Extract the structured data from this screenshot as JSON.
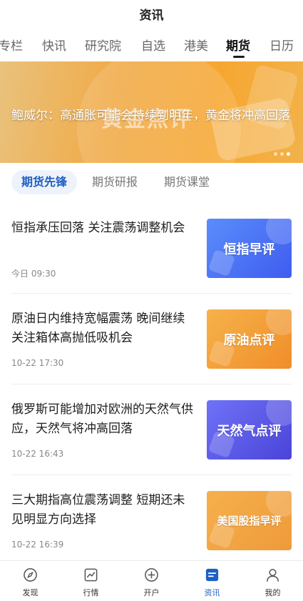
{
  "header": {
    "title": "资讯"
  },
  "tabs": [
    {
      "label": "专栏"
    },
    {
      "label": "快讯"
    },
    {
      "label": "研究院"
    },
    {
      "label": "自选"
    },
    {
      "label": "港美"
    },
    {
      "label": "期货",
      "active": true
    },
    {
      "label": "日历"
    }
  ],
  "banner": {
    "caption": "鲍威尔：高通胀可能会持续到明年，黄金将冲高回落",
    "watermark": "黄金点评",
    "slide_count": 3,
    "active_slide": 3
  },
  "subtabs": [
    {
      "label": "期货先锋",
      "active": true
    },
    {
      "label": "期货研报"
    },
    {
      "label": "期货课堂"
    }
  ],
  "news": [
    {
      "title": "恒指承压回落 关注震荡调整机会",
      "time": "今日 09:30",
      "thumb_label": "恒指早评",
      "thumb_color": "#4f6ff2"
    },
    {
      "title": "原油日内维持宽幅震荡 晚间继续关注箱体高抛低吸机会",
      "time": "10-22 17:30",
      "thumb_label": "原油点评",
      "thumb_color": "#f3a23b"
    },
    {
      "title": "俄罗斯可能增加对欧洲的天然气供应，天然气将冲高回落",
      "time": "10-22 16:43",
      "thumb_label": "天然气点评",
      "thumb_color": "#5a55e6"
    },
    {
      "title": "三大期指高位震荡调整 短期还未见明显方向选择",
      "time": "10-22 16:39",
      "thumb_label": "美国股指早评",
      "thumb_color": "#f2a444"
    }
  ],
  "bottom_nav": [
    {
      "label": "发现",
      "icon": "compass-icon"
    },
    {
      "label": "行情",
      "icon": "chart-icon"
    },
    {
      "label": "开户",
      "icon": "plus-circle-icon"
    },
    {
      "label": "资讯",
      "icon": "news-icon",
      "active": true
    },
    {
      "label": "我的",
      "icon": "user-icon"
    }
  ],
  "colors": {
    "accent": "#1f5fc4",
    "banner": "#f3a93b"
  }
}
